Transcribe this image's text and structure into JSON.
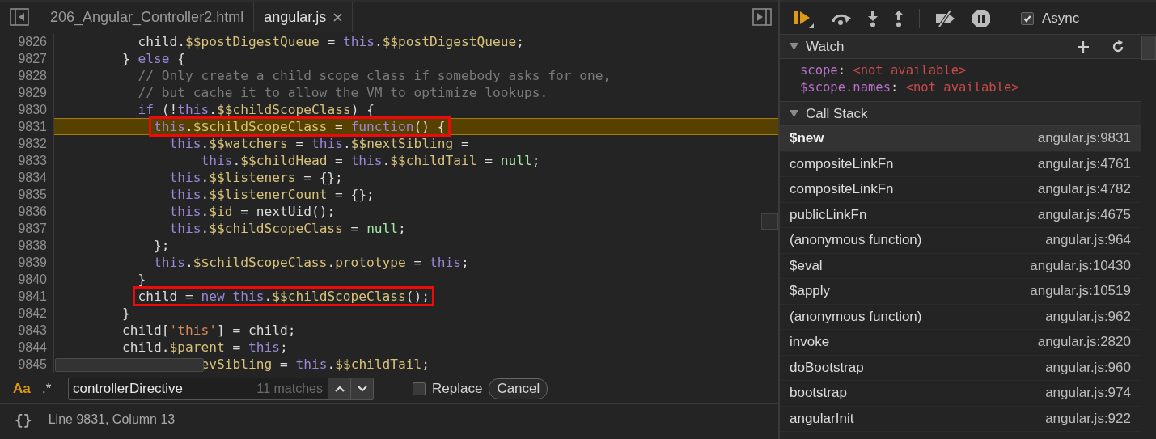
{
  "tabs": [
    {
      "label": "206_Angular_Controller2.html",
      "selected": false,
      "closable": false
    },
    {
      "label": "angular.js",
      "selected": true,
      "closable": true
    }
  ],
  "code": {
    "lines": [
      {
        "number": "9826",
        "highlighted": false,
        "boxed": false,
        "tokens": [
          {
            "kind": "plain",
            "text": "          child."
          },
          {
            "kind": "prop",
            "text": "$$postDigestQueue"
          },
          {
            "kind": "plain",
            "text": " = "
          },
          {
            "kind": "keyword",
            "text": "this"
          },
          {
            "kind": "plain",
            "text": "."
          },
          {
            "kind": "prop",
            "text": "$$postDigestQueue"
          },
          {
            "kind": "plain",
            "text": ";"
          }
        ]
      },
      {
        "number": "9827",
        "highlighted": false,
        "boxed": false,
        "tokens": [
          {
            "kind": "plain",
            "text": "        } "
          },
          {
            "kind": "keyword",
            "text": "else"
          },
          {
            "kind": "plain",
            "text": " {"
          }
        ]
      },
      {
        "number": "9828",
        "highlighted": false,
        "boxed": false,
        "tokens": [
          {
            "kind": "comment",
            "text": "          // Only create a child scope class if somebody asks for one,"
          }
        ]
      },
      {
        "number": "9829",
        "highlighted": false,
        "boxed": false,
        "tokens": [
          {
            "kind": "comment",
            "text": "          // but cache it to allow the VM to optimize lookups."
          }
        ]
      },
      {
        "number": "9830",
        "highlighted": false,
        "boxed": false,
        "tokens": [
          {
            "kind": "keyword",
            "text": "          if"
          },
          {
            "kind": "plain",
            "text": " (!"
          },
          {
            "kind": "keyword",
            "text": "this"
          },
          {
            "kind": "plain",
            "text": "."
          },
          {
            "kind": "prop",
            "text": "$$childScopeClass"
          },
          {
            "kind": "plain",
            "text": ") {"
          }
        ]
      },
      {
        "number": "9831",
        "highlighted": true,
        "boxed": true,
        "tokens": [
          {
            "kind": "keyword",
            "text": "            this"
          },
          {
            "kind": "plain",
            "text": "."
          },
          {
            "kind": "prop",
            "text": "$$childScopeClass"
          },
          {
            "kind": "plain",
            "text": " = "
          },
          {
            "kind": "keyword",
            "text": "function"
          },
          {
            "kind": "plain",
            "text": "() {"
          }
        ]
      },
      {
        "number": "9832",
        "highlighted": false,
        "boxed": false,
        "tokens": [
          {
            "kind": "keyword",
            "text": "              this"
          },
          {
            "kind": "plain",
            "text": "."
          },
          {
            "kind": "prop",
            "text": "$$watchers"
          },
          {
            "kind": "plain",
            "text": " = "
          },
          {
            "kind": "keyword",
            "text": "this"
          },
          {
            "kind": "plain",
            "text": "."
          },
          {
            "kind": "prop",
            "text": "$$nextSibling"
          },
          {
            "kind": "plain",
            "text": " ="
          }
        ]
      },
      {
        "number": "9833",
        "highlighted": false,
        "boxed": false,
        "tokens": [
          {
            "kind": "keyword",
            "text": "                  this"
          },
          {
            "kind": "plain",
            "text": "."
          },
          {
            "kind": "prop",
            "text": "$$childHead"
          },
          {
            "kind": "plain",
            "text": " = "
          },
          {
            "kind": "keyword",
            "text": "this"
          },
          {
            "kind": "plain",
            "text": "."
          },
          {
            "kind": "prop",
            "text": "$$childTail"
          },
          {
            "kind": "plain",
            "text": " = "
          },
          {
            "kind": "literal",
            "text": "null"
          },
          {
            "kind": "plain",
            "text": ";"
          }
        ]
      },
      {
        "number": "9834",
        "highlighted": false,
        "boxed": false,
        "tokens": [
          {
            "kind": "keyword",
            "text": "              this"
          },
          {
            "kind": "plain",
            "text": "."
          },
          {
            "kind": "prop",
            "text": "$$listeners"
          },
          {
            "kind": "plain",
            "text": " = {};"
          }
        ]
      },
      {
        "number": "9835",
        "highlighted": false,
        "boxed": false,
        "tokens": [
          {
            "kind": "keyword",
            "text": "              this"
          },
          {
            "kind": "plain",
            "text": "."
          },
          {
            "kind": "prop",
            "text": "$$listenerCount"
          },
          {
            "kind": "plain",
            "text": " = {};"
          }
        ]
      },
      {
        "number": "9836",
        "highlighted": false,
        "boxed": false,
        "tokens": [
          {
            "kind": "keyword",
            "text": "              this"
          },
          {
            "kind": "plain",
            "text": "."
          },
          {
            "kind": "prop",
            "text": "$id"
          },
          {
            "kind": "plain",
            "text": " = nextUid();"
          }
        ]
      },
      {
        "number": "9837",
        "highlighted": false,
        "boxed": false,
        "tokens": [
          {
            "kind": "keyword",
            "text": "              this"
          },
          {
            "kind": "plain",
            "text": "."
          },
          {
            "kind": "prop",
            "text": "$$childScopeClass"
          },
          {
            "kind": "plain",
            "text": " = "
          },
          {
            "kind": "literal",
            "text": "null"
          },
          {
            "kind": "plain",
            "text": ";"
          }
        ]
      },
      {
        "number": "9838",
        "highlighted": false,
        "boxed": false,
        "tokens": [
          {
            "kind": "plain",
            "text": "            };"
          }
        ]
      },
      {
        "number": "9839",
        "highlighted": false,
        "boxed": false,
        "tokens": [
          {
            "kind": "keyword",
            "text": "            this"
          },
          {
            "kind": "plain",
            "text": "."
          },
          {
            "kind": "prop",
            "text": "$$childScopeClass"
          },
          {
            "kind": "plain",
            "text": "."
          },
          {
            "kind": "prop",
            "text": "prototype"
          },
          {
            "kind": "plain",
            "text": " = "
          },
          {
            "kind": "keyword",
            "text": "this"
          },
          {
            "kind": "plain",
            "text": ";"
          }
        ]
      },
      {
        "number": "9840",
        "highlighted": false,
        "boxed": false,
        "tokens": [
          {
            "kind": "plain",
            "text": "          }"
          }
        ]
      },
      {
        "number": "9841",
        "highlighted": false,
        "boxed": true,
        "tokens": [
          {
            "kind": "plain",
            "text": "          child = "
          },
          {
            "kind": "keyword",
            "text": "new this"
          },
          {
            "kind": "plain",
            "text": "."
          },
          {
            "kind": "prop",
            "text": "$$childScopeClass"
          },
          {
            "kind": "plain",
            "text": "();"
          }
        ]
      },
      {
        "number": "9842",
        "highlighted": false,
        "boxed": false,
        "tokens": [
          {
            "kind": "plain",
            "text": "        }"
          }
        ]
      },
      {
        "number": "9843",
        "highlighted": false,
        "boxed": false,
        "tokens": [
          {
            "kind": "plain",
            "text": "        child["
          },
          {
            "kind": "string",
            "text": "'this'"
          },
          {
            "kind": "plain",
            "text": "] = child;"
          }
        ]
      },
      {
        "number": "9844",
        "highlighted": false,
        "boxed": false,
        "tokens": [
          {
            "kind": "plain",
            "text": "        child."
          },
          {
            "kind": "prop",
            "text": "$parent"
          },
          {
            "kind": "plain",
            "text": " = "
          },
          {
            "kind": "keyword",
            "text": "this"
          },
          {
            "kind": "plain",
            "text": ";"
          }
        ]
      },
      {
        "number": "9845",
        "highlighted": false,
        "boxed": false,
        "tokens": [
          {
            "kind": "prop",
            "text": "                  evSibling"
          },
          {
            "kind": "plain",
            "text": " = "
          },
          {
            "kind": "keyword",
            "text": "this"
          },
          {
            "kind": "plain",
            "text": "."
          },
          {
            "kind": "prop",
            "text": "$$childTail"
          },
          {
            "kind": "plain",
            "text": ";"
          }
        ]
      }
    ]
  },
  "search": {
    "case_sensitive": {
      "label": "Aa",
      "on": true
    },
    "regex": {
      "label": ".*",
      "on": false
    },
    "value": "controllerDirective",
    "match_count": "11 matches",
    "replace": {
      "label": "Replace",
      "checked": false
    },
    "cancel": "Cancel"
  },
  "status_bar": {
    "format_button": "{}",
    "position": "Line 9831, Column 13"
  },
  "debug_toolbar": {
    "async": {
      "label": "Async",
      "checked": true
    }
  },
  "watch": {
    "title": "Watch",
    "expanded": true,
    "expressions": [
      {
        "name": "scope",
        "separator": ":",
        "value": "<not available>"
      },
      {
        "name": "$scope.names",
        "separator": ":",
        "value": "<not available>"
      }
    ]
  },
  "call_stack": {
    "title": "Call Stack",
    "expanded": true,
    "frames": [
      {
        "name": "$new",
        "location": "angular.js:9831",
        "selected": true
      },
      {
        "name": "compositeLinkFn",
        "location": "angular.js:4761",
        "selected": false
      },
      {
        "name": "compositeLinkFn",
        "location": "angular.js:4782",
        "selected": false
      },
      {
        "name": "publicLinkFn",
        "location": "angular.js:4675",
        "selected": false
      },
      {
        "name": "(anonymous function)",
        "location": "angular.js:964",
        "selected": false
      },
      {
        "name": "$eval",
        "location": "angular.js:10430",
        "selected": false
      },
      {
        "name": "$apply",
        "location": "angular.js:10519",
        "selected": false
      },
      {
        "name": "(anonymous function)",
        "location": "angular.js:962",
        "selected": false
      },
      {
        "name": "invoke",
        "location": "angular.js:2820",
        "selected": false
      },
      {
        "name": "doBootstrap",
        "location": "angular.js:960",
        "selected": false
      },
      {
        "name": "bootstrap",
        "location": "angular.js:974",
        "selected": false
      },
      {
        "name": "angularInit",
        "location": "angular.js:922",
        "selected": false
      }
    ]
  }
}
